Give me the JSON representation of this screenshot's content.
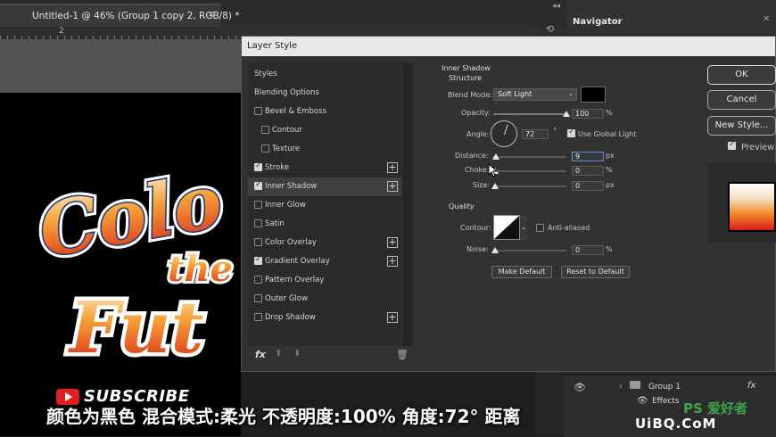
{
  "document": {
    "tab_title": "Untitled-1 @ 46% (Group 1 copy 2, RGB/8) *",
    "close_glyph": "×",
    "ruler_number": "2"
  },
  "navigator": {
    "title": "Navigator"
  },
  "dialog": {
    "title": "Layer Style",
    "styles_header": "Styles",
    "blending_options": "Blending Options",
    "items": [
      {
        "label": "Bevel & Emboss",
        "checked": false,
        "plus": false,
        "indent": false,
        "selected": false
      },
      {
        "label": "Contour",
        "checked": false,
        "plus": false,
        "indent": true,
        "selected": false
      },
      {
        "label": "Texture",
        "checked": false,
        "plus": false,
        "indent": true,
        "selected": false
      },
      {
        "label": "Stroke",
        "checked": true,
        "plus": true,
        "indent": false,
        "selected": false
      },
      {
        "label": "Inner Shadow",
        "checked": true,
        "plus": true,
        "indent": false,
        "selected": true
      },
      {
        "label": "Inner Glow",
        "checked": false,
        "plus": false,
        "indent": false,
        "selected": false
      },
      {
        "label": "Satin",
        "checked": false,
        "plus": false,
        "indent": false,
        "selected": false
      },
      {
        "label": "Color Overlay",
        "checked": false,
        "plus": true,
        "indent": false,
        "selected": false
      },
      {
        "label": "Gradient Overlay",
        "checked": true,
        "plus": true,
        "indent": false,
        "selected": false
      },
      {
        "label": "Pattern Overlay",
        "checked": false,
        "plus": false,
        "indent": false,
        "selected": false
      },
      {
        "label": "Outer Glow",
        "checked": false,
        "plus": false,
        "indent": false,
        "selected": false
      },
      {
        "label": "Drop Shadow",
        "checked": false,
        "plus": true,
        "indent": false,
        "selected": false
      }
    ],
    "footer": {
      "fx": "fx",
      "up": "⬆",
      "down": "⬇",
      "trash": "🗑"
    },
    "inner_shadow": {
      "section_title": "Inner Shadow",
      "structure_title": "Structure",
      "blend_mode_label": "Blend Mode:",
      "blend_mode_value": "Soft Light",
      "shadow_color": "#000000",
      "opacity_label": "Opacity:",
      "opacity_value": "100",
      "opacity_fraction": 1.0,
      "angle_label": "Angle:",
      "angle_value": "72",
      "degree_sign": "°",
      "use_global_light": "Use Global Light",
      "distance_label": "Distance:",
      "distance_value": "9",
      "distance_fraction": 0.04,
      "choke_label": "Choke:",
      "choke_value": "0",
      "size_label": "Size:",
      "size_value": "0",
      "px": "px",
      "percent": "%",
      "quality_title": "Quality",
      "contour_label": "Contour:",
      "anti_aliased": "Anti-aliased",
      "noise_label": "Noise:",
      "noise_value": "0",
      "make_default": "Make Default",
      "reset_default": "Reset to Default"
    },
    "buttons": {
      "ok": "OK",
      "cancel": "Cancel",
      "new_style": "New Style...",
      "preview": "Preview"
    }
  },
  "layers": {
    "group_name": "Group 1",
    "fx": "fx",
    "effects": "Effects",
    "eye": "👁"
  },
  "artwork": {
    "line1": "Colo",
    "line2": "the",
    "line3": "Fut",
    "subscribe": "SUBSCRIBE"
  },
  "watermark": {
    "line1": "PS 爱好者",
    "line2": "UiBQ.CoM"
  },
  "subtitle": "颜色为黑色 混合模式:柔光 不透明度:100% 角度:72° 距离"
}
